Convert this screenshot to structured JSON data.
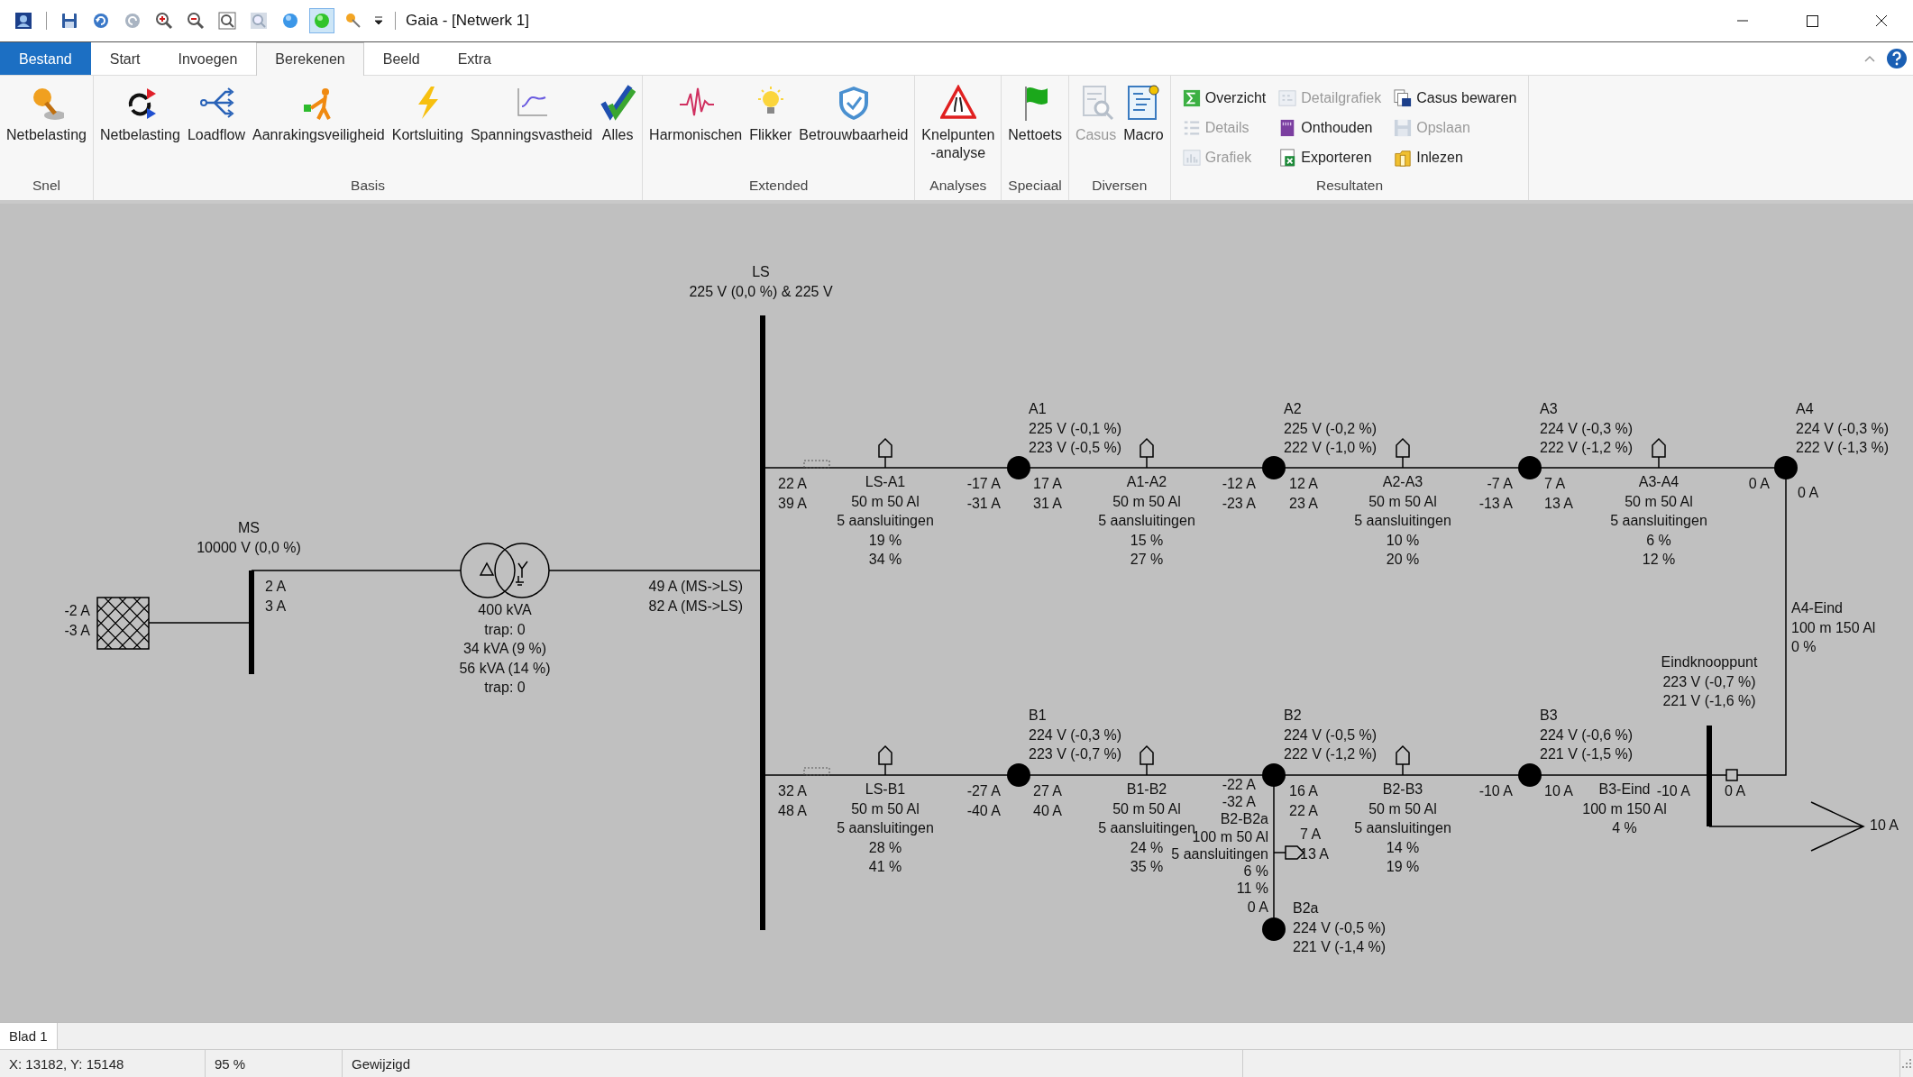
{
  "window": {
    "title": "Gaia - [Netwerk 1]"
  },
  "quick_access": [
    {
      "selected": false
    },
    {
      "selected": false
    },
    {
      "selected": false
    },
    {
      "selected": false
    },
    {
      "selected": false
    },
    {
      "selected": false
    },
    {
      "selected": false
    },
    {
      "selected": false
    },
    {
      "selected": false
    },
    {
      "selected": true
    },
    {
      "selected": false
    }
  ],
  "ribbon_tabs": [
    {
      "label": "Bestand",
      "kind": "file",
      "selected": false
    },
    {
      "label": "Start",
      "kind": "tab",
      "selected": false
    },
    {
      "label": "Invoegen",
      "kind": "tab",
      "selected": false
    },
    {
      "label": "Berekenen",
      "kind": "tab",
      "selected": true
    },
    {
      "label": "Beeld",
      "kind": "tab",
      "selected": false
    },
    {
      "label": "Extra",
      "kind": "tab",
      "selected": false
    }
  ],
  "ribbon_groups": [
    {
      "label": "Snel",
      "kind": "large",
      "buttons": [
        {
          "label": "Netbelasting",
          "disabled": false
        }
      ]
    },
    {
      "label": "Basis",
      "kind": "large",
      "buttons": [
        {
          "label": "Netbelasting",
          "disabled": false
        },
        {
          "label": "Loadflow",
          "disabled": false
        },
        {
          "label": "Aanrakingsveiligheid",
          "disabled": false
        },
        {
          "label": "Kortsluiting",
          "disabled": false
        },
        {
          "label": "Spanningsvastheid",
          "disabled": false
        },
        {
          "label": "Alles",
          "disabled": false
        }
      ]
    },
    {
      "label": "Extended",
      "kind": "large",
      "buttons": [
        {
          "label": "Harmonischen",
          "disabled": false
        },
        {
          "label": "Flikker",
          "disabled": false
        },
        {
          "label": "Betrouwbaarheid",
          "disabled": false
        }
      ]
    },
    {
      "label": "Analyses",
      "kind": "large",
      "buttons": [
        {
          "label": "Knelpunten\n-analyse",
          "disabled": false
        }
      ]
    },
    {
      "label": "Speciaal",
      "kind": "large",
      "buttons": [
        {
          "label": "Nettoets",
          "disabled": false
        }
      ]
    },
    {
      "label": "Diversen",
      "kind": "large",
      "buttons": [
        {
          "label": "Casus",
          "disabled": true
        },
        {
          "label": "Macro",
          "disabled": false
        }
      ]
    },
    {
      "label": "Resultaten",
      "kind": "small",
      "buttons": [
        {
          "label": "Overzicht",
          "disabled": false
        },
        {
          "label": "Details",
          "disabled": true
        },
        {
          "label": "Grafiek",
          "disabled": true
        },
        {
          "label": "Detailgrafiek",
          "disabled": true
        },
        {
          "label": "Onthouden",
          "disabled": false
        },
        {
          "label": "Exporteren",
          "disabled": false
        },
        {
          "label": "Casus bewaren",
          "disabled": false
        },
        {
          "label": "Opslaan",
          "disabled": true
        },
        {
          "label": "Inlezen",
          "disabled": false
        }
      ]
    }
  ],
  "diagram": {
    "buses": [
      {
        "name": "LS",
        "lines": [
          "225 V (0,0 %) & 225 V"
        ]
      },
      {
        "name": "MS",
        "lines": [
          "10000 V (0,0 %)"
        ]
      },
      {
        "name": "Eindknooppunt",
        "lines": [
          "223 V (-0,7 %)",
          "221 V (-1,6 %)"
        ]
      }
    ],
    "transformer": {
      "lines": [
        "400 kVA",
        "trap: 0",
        "34 kVA (9 %)",
        "56 kVA (14 %)",
        "trap: 0"
      ]
    },
    "nodes": [
      {
        "name": "A1",
        "lines": [
          "225 V (-0,1 %)",
          "223 V (-0,5 %)"
        ]
      },
      {
        "name": "A2",
        "lines": [
          "225 V (-0,2 %)",
          "222 V (-1,0 %)"
        ]
      },
      {
        "name": "A3",
        "lines": [
          "224 V (-0,3 %)",
          "222 V (-1,2 %)"
        ]
      },
      {
        "name": "A4",
        "lines": [
          "224 V (-0,3 %)",
          "222 V (-1,3 %)"
        ]
      },
      {
        "name": "B1",
        "lines": [
          "224 V (-0,3 %)",
          "223 V (-0,7 %)"
        ]
      },
      {
        "name": "B2",
        "lines": [
          "224 V (-0,5 %)",
          "222 V (-1,2 %)"
        ]
      },
      {
        "name": "B3",
        "lines": [
          "224 V (-0,6 %)",
          "221 V (-1,5 %)"
        ]
      },
      {
        "name": "B2a",
        "lines": [
          "224 V (-0,5 %)",
          "221 V (-1,4 %)"
        ]
      }
    ],
    "cables": [
      {
        "name": "LS-A1",
        "lines": [
          "50 m 50 Al",
          "5 aansluitingen",
          "19 %",
          "34 %"
        ]
      },
      {
        "name": "A1-A2",
        "lines": [
          "50 m 50 Al",
          "5 aansluitingen",
          "15 %",
          "27 %"
        ]
      },
      {
        "name": "A2-A3",
        "lines": [
          "50 m 50 Al",
          "5 aansluitingen",
          "10 %",
          "20 %"
        ]
      },
      {
        "name": "A3-A4",
        "lines": [
          "50 m 50 Al",
          "5 aansluitingen",
          "6 %",
          "12 %"
        ]
      },
      {
        "name": "A4-Eind",
        "lines": [
          "100 m 150 Al",
          "0 %"
        ]
      },
      {
        "name": "LS-B1",
        "lines": [
          "50 m 50 Al",
          "5 aansluitingen",
          "28 %",
          "41 %"
        ]
      },
      {
        "name": "B1-B2",
        "lines": [
          "50 m 50 Al",
          "5 aansluitingen",
          "24 %",
          "35 %"
        ]
      },
      {
        "name": "B2-B3",
        "lines": [
          "50 m 50 Al",
          "5 aansluitingen",
          "14 %",
          "19 %"
        ]
      },
      {
        "name": "B3-Eind",
        "lines": [
          "100 m 150 Al",
          "4 %"
        ]
      },
      {
        "name": "B2-B2a",
        "lines": [
          "100 m 50 Al",
          "5 aansluitingen",
          "6 %",
          "11 %"
        ]
      }
    ],
    "currents": [
      {
        "lines": [
          "-2 A",
          "-3 A"
        ]
      },
      {
        "lines": [
          "2 A",
          "3 A"
        ]
      },
      {
        "lines": [
          "49 A (MS->LS)",
          "82 A (MS->LS)"
        ]
      },
      {
        "lines": [
          "22 A",
          "39 A"
        ]
      },
      {
        "lines": [
          "-17 A",
          "-31 A"
        ]
      },
      {
        "lines": [
          "17 A",
          "31 A"
        ]
      },
      {
        "lines": [
          "-12 A",
          "-23 A"
        ]
      },
      {
        "lines": [
          "12 A",
          "23 A"
        ]
      },
      {
        "lines": [
          "-7 A",
          "-13 A"
        ]
      },
      {
        "lines": [
          "7 A",
          "13 A"
        ]
      },
      {
        "lines": [
          "0 A"
        ]
      },
      {
        "lines": [
          "0 A"
        ]
      },
      {
        "lines": [
          "32 A",
          "48 A"
        ]
      },
      {
        "lines": [
          "-27 A",
          "-40 A"
        ]
      },
      {
        "lines": [
          "27 A",
          "40 A"
        ]
      },
      {
        "lines": [
          "-22 A",
          "-32 A"
        ]
      },
      {
        "lines": [
          "16 A",
          "22 A"
        ]
      },
      {
        "lines": [
          "-10 A"
        ]
      },
      {
        "lines": [
          "10 A"
        ]
      },
      {
        "lines": [
          "-10 A"
        ]
      },
      {
        "lines": [
          "0 A"
        ]
      },
      {
        "lines": [
          "7 A",
          "13 A"
        ]
      },
      {
        "lines": [
          "10 A"
        ]
      },
      {
        "lines": [
          "0 A"
        ]
      }
    ]
  },
  "sheet_tabs": [
    {
      "label": "Blad 1",
      "selected": true
    }
  ],
  "status_bar": [
    "X: 13182, Y: 15148",
    "95 %",
    "Gewijzigd"
  ]
}
